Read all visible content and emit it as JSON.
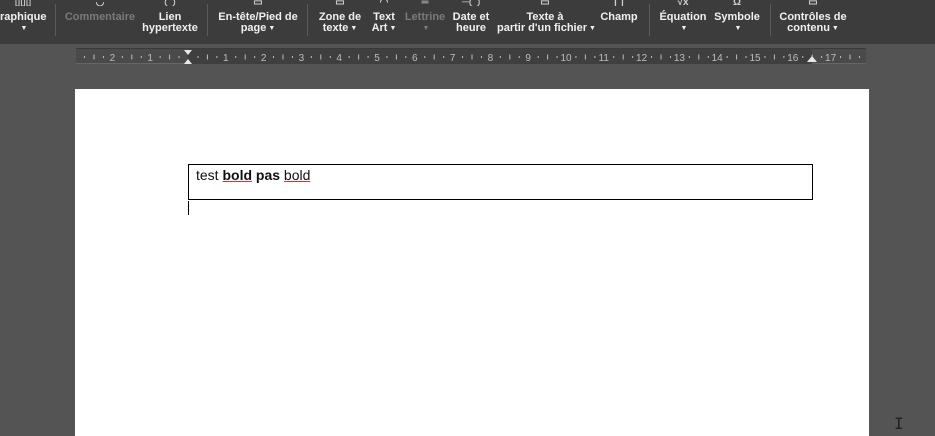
{
  "toolbar": {
    "graphique": {
      "label": "raphique"
    },
    "commentaire": {
      "label": "Commentaire"
    },
    "lien": {
      "line1": "Lien",
      "line2": "hypertexte"
    },
    "entete": {
      "line1": "En-tête/Pied de",
      "line2": "page"
    },
    "zone": {
      "line1": "Zone de",
      "line2": "texte"
    },
    "textart": {
      "line1": "Text",
      "line2": "Art"
    },
    "lettrine": {
      "label": "Lettrine"
    },
    "date": {
      "line1": "Date et",
      "line2": "heure"
    },
    "texte_fichier": {
      "line1": "Texte à",
      "line2": "partir d'un fichier"
    },
    "champ": {
      "label": "Champ"
    },
    "equation": {
      "label": "Équation"
    },
    "symbole": {
      "label": "Symbole"
    },
    "controles": {
      "line1": "Contrôles de",
      "line2": "contenu"
    }
  },
  "ruler": {
    "labels_left": [
      "2",
      "1"
    ],
    "labels_right": [
      "1",
      "2",
      "3",
      "4",
      "5",
      "6",
      "7",
      "8",
      "9",
      "10",
      "11",
      "12",
      "13",
      "14",
      "15",
      "16",
      "17"
    ]
  },
  "document": {
    "cell": {
      "word1": "test",
      "word2": "bold",
      "word3": "pas",
      "word4": "bold"
    }
  },
  "mouse_cursor": "I"
}
